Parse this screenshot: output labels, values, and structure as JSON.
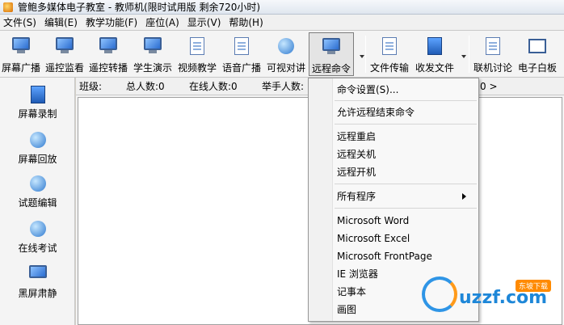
{
  "window": {
    "title": "管鲍多媒体电子教室 - 教师机(限时试用版 剩余720小时)"
  },
  "menubar": {
    "items": [
      "文件(S)",
      "编辑(E)",
      "教学功能(F)",
      "座位(A)",
      "显示(V)",
      "帮助(H)"
    ]
  },
  "toolbar": {
    "buttons": [
      {
        "label": "屏幕广播",
        "icon": "screen-broadcast-icon"
      },
      {
        "label": "遥控监看",
        "icon": "remote-watch-icon"
      },
      {
        "label": "遥控转播",
        "icon": "remote-relay-icon"
      },
      {
        "label": "学生演示",
        "icon": "student-demo-icon"
      },
      {
        "label": "视频教学",
        "icon": "video-teaching-icon"
      },
      {
        "label": "语音广播",
        "icon": "voice-broadcast-icon"
      },
      {
        "label": "可视对讲",
        "icon": "video-intercom-icon"
      },
      {
        "label": "远程命令",
        "icon": "remote-command-icon"
      },
      {
        "label": "文件传输",
        "icon": "file-transfer-icon"
      },
      {
        "label": "收发文件",
        "icon": "send-receive-files-icon"
      },
      {
        "label": "联机讨论",
        "icon": "online-discussion-icon"
      },
      {
        "label": "电子白板",
        "icon": "whiteboard-icon"
      }
    ]
  },
  "leftbar": {
    "items": [
      {
        "label": "屏幕录制",
        "icon": "screen-record-icon"
      },
      {
        "label": "屏幕回放",
        "icon": "screen-playback-icon"
      },
      {
        "label": "试题编辑",
        "icon": "question-edit-icon"
      },
      {
        "label": "在线考试",
        "icon": "online-exam-icon"
      },
      {
        "label": "黑屏肃静",
        "icon": "black-screen-icon"
      }
    ]
  },
  "infobar": {
    "class_label": "班级:",
    "total_label": "总人数:0",
    "online_label": "在线人数:0",
    "hands_label": "举手人数:",
    "trailing": "0 >"
  },
  "context_menu": {
    "items": [
      "命令设置(S)...",
      "允许远程结束命令",
      "远程重启",
      "远程关机",
      "远程开机",
      "所有程序",
      "Microsoft Word",
      "Microsoft Excel",
      "Microsoft FrontPage",
      "IE 浏览器",
      "记事本",
      "画图"
    ]
  },
  "watermark": {
    "text": "uzzf.com",
    "badge": "东坡下载"
  },
  "colors": {
    "accent": "#2f95e6",
    "brand_orange": "#ff8a00"
  }
}
